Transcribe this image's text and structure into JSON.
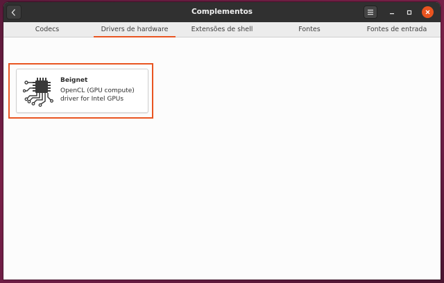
{
  "window": {
    "title": "Complementos",
    "close_color": "#e95420",
    "accent_color": "#e95420"
  },
  "titlebar": {
    "back_icon": "chevron-left-icon",
    "menu_icon": "hamburger-menu-icon",
    "minimize_icon": "minimize-icon",
    "maximize_icon": "maximize-icon",
    "close_icon": "close-icon"
  },
  "tabs": [
    {
      "label": "Codecs",
      "active": false
    },
    {
      "label": "Drivers de hardware",
      "active": true
    },
    {
      "label": "Extensões de shell",
      "active": false
    },
    {
      "label": "Fontes",
      "active": false
    },
    {
      "label": "Fontes de entrada",
      "active": false
    }
  ],
  "drivers": [
    {
      "name": "Beignet",
      "description": "OpenCL (GPU compute) driver for Intel GPUs",
      "icon": "chip-circuit-icon"
    }
  ]
}
